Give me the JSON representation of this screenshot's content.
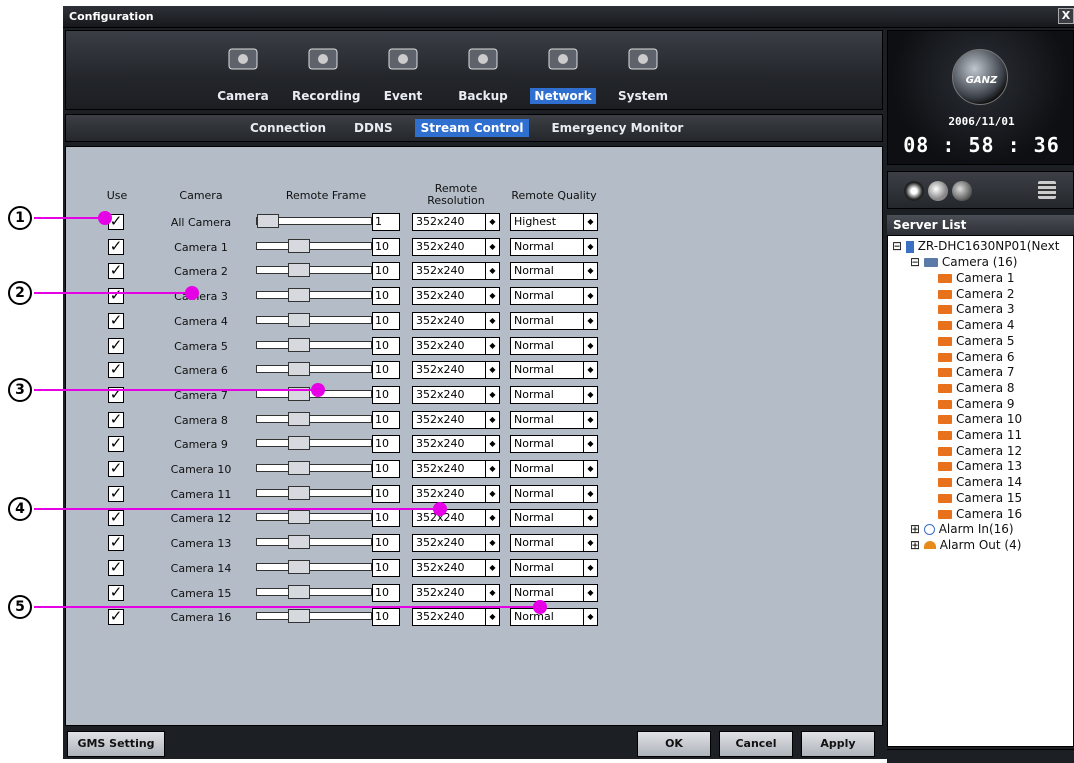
{
  "window": {
    "title": "Configuration",
    "close_label": "X"
  },
  "topnav": [
    {
      "label": "Camera",
      "icon": "camera-icon"
    },
    {
      "label": "Recording",
      "icon": "recording-icon"
    },
    {
      "label": "Event",
      "icon": "event-icon"
    },
    {
      "label": "Backup",
      "icon": "backup-icon"
    },
    {
      "label": "Network",
      "icon": "network-icon",
      "active": true
    },
    {
      "label": "System",
      "icon": "system-icon"
    }
  ],
  "subnav": [
    {
      "label": "Connection"
    },
    {
      "label": "DDNS"
    },
    {
      "label": "Stream Control",
      "active": true
    },
    {
      "label": "Emergency Monitor"
    }
  ],
  "table": {
    "headers": {
      "use": "Use",
      "camera": "Camera",
      "frame": "Remote Frame",
      "resolution": "Remote\nResolution",
      "quality": "Remote Quality"
    },
    "rows": [
      {
        "camera": "All Camera",
        "frame": "1",
        "resolution": "352x240",
        "quality": "Highest",
        "frame_level": 0.0
      },
      {
        "camera": "Camera 1",
        "frame": "10",
        "resolution": "352x240",
        "quality": "Normal",
        "frame_level": 0.33
      },
      {
        "camera": "Camera 2",
        "frame": "10",
        "resolution": "352x240",
        "quality": "Normal",
        "frame_level": 0.33
      },
      {
        "camera": "Camera 3",
        "frame": "10",
        "resolution": "352x240",
        "quality": "Normal",
        "frame_level": 0.33
      },
      {
        "camera": "Camera 4",
        "frame": "10",
        "resolution": "352x240",
        "quality": "Normal",
        "frame_level": 0.33
      },
      {
        "camera": "Camera 5",
        "frame": "10",
        "resolution": "352x240",
        "quality": "Normal",
        "frame_level": 0.33
      },
      {
        "camera": "Camera 6",
        "frame": "10",
        "resolution": "352x240",
        "quality": "Normal",
        "frame_level": 0.33
      },
      {
        "camera": "Camera 7",
        "frame": "10",
        "resolution": "352x240",
        "quality": "Normal",
        "frame_level": 0.33
      },
      {
        "camera": "Camera 8",
        "frame": "10",
        "resolution": "352x240",
        "quality": "Normal",
        "frame_level": 0.33
      },
      {
        "camera": "Camera 9",
        "frame": "10",
        "resolution": "352x240",
        "quality": "Normal",
        "frame_level": 0.33
      },
      {
        "camera": "Camera 10",
        "frame": "10",
        "resolution": "352x240",
        "quality": "Normal",
        "frame_level": 0.33
      },
      {
        "camera": "Camera 11",
        "frame": "10",
        "resolution": "352x240",
        "quality": "Normal",
        "frame_level": 0.33
      },
      {
        "camera": "Camera 12",
        "frame": "10",
        "resolution": "352x240",
        "quality": "Normal",
        "frame_level": 0.33
      },
      {
        "camera": "Camera 13",
        "frame": "10",
        "resolution": "352x240",
        "quality": "Normal",
        "frame_level": 0.33
      },
      {
        "camera": "Camera 14",
        "frame": "10",
        "resolution": "352x240",
        "quality": "Normal",
        "frame_level": 0.33
      },
      {
        "camera": "Camera 15",
        "frame": "10",
        "resolution": "352x240",
        "quality": "Normal",
        "frame_level": 0.33
      },
      {
        "camera": "Camera 16",
        "frame": "10",
        "resolution": "352x240",
        "quality": "Normal",
        "frame_level": 0.33
      }
    ]
  },
  "buttons": {
    "gms": "GMS Setting",
    "ok": "OK",
    "cancel": "Cancel",
    "apply": "Apply"
  },
  "clock": {
    "brand": "GANZ",
    "date": "2006/11/01",
    "time": "08 : 58 : 36"
  },
  "server_list": {
    "title": "Server List",
    "server": "ZR-DHC1630NP01(Next",
    "camera_group": "Camera (16)",
    "cameras": [
      "Camera 1",
      "Camera 2",
      "Camera 3",
      "Camera 4",
      "Camera 5",
      "Camera 6",
      "Camera 7",
      "Camera 8",
      "Camera 9",
      "Camera 10",
      "Camera 11",
      "Camera 12",
      "Camera 13",
      "Camera 14",
      "Camera 15",
      "Camera 16"
    ],
    "alarm_in": "Alarm In(16)",
    "alarm_out": "Alarm Out (4)"
  },
  "callouts": [
    "1",
    "2",
    "3",
    "4",
    "5"
  ],
  "colors": {
    "accent": "#2f6fd0",
    "callout_line": "#e600e6",
    "panel": "#b4bcc7"
  }
}
